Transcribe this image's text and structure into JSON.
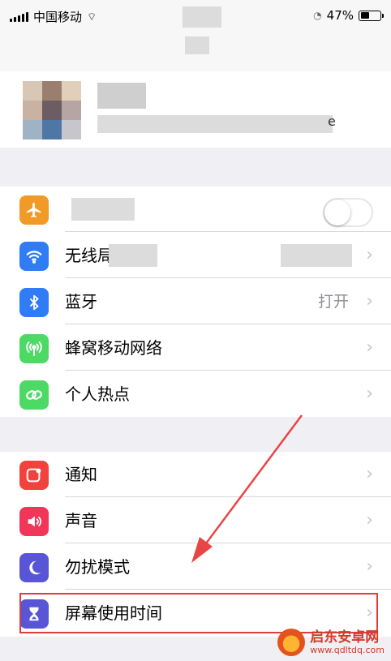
{
  "status_bar": {
    "carrier": "中国移动",
    "battery_percent": "47%",
    "battery_level": 0.47
  },
  "settings": {
    "toggle_row": {
      "label": "",
      "on": false
    },
    "rows_group1": [
      {
        "label": "无线局",
        "value": "",
        "icon": "wifi-icon",
        "color": "#2f7cf6"
      },
      {
        "label": "蓝牙",
        "value": "打开",
        "icon": "bluetooth-icon",
        "color": "#2f7cf6"
      },
      {
        "label": "蜂窝移动网络",
        "value": "",
        "icon": "cellular-antenna-icon",
        "color": "#4cd964"
      },
      {
        "label": "个人热点",
        "value": "",
        "icon": "hotspot-link-icon",
        "color": "#4cd964"
      }
    ],
    "rows_group2": [
      {
        "label": "通知",
        "value": "",
        "icon": "notifications-icon",
        "color": "#f2423d"
      },
      {
        "label": "声音",
        "value": "",
        "icon": "speaker-icon",
        "color": "#f2365a"
      },
      {
        "label": "勿扰模式",
        "value": "",
        "icon": "moon-icon",
        "color": "#5856d6"
      },
      {
        "label": "屏幕使用时间",
        "value": "",
        "icon": "hourglass-icon",
        "color": "#5856d6"
      }
    ],
    "chevron": "›"
  },
  "watermark": {
    "title": "启东安卓网",
    "url": "www.qdltdq.com"
  },
  "annotation": {
    "highlight_color": "#e03c3c",
    "arrow_color": "#e84545"
  }
}
